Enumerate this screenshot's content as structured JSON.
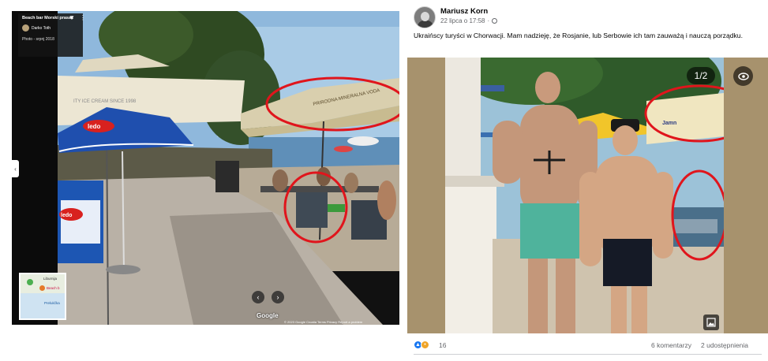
{
  "street_view": {
    "place_title": "Beach bar Morski prasac",
    "contributor": "Darko Toth",
    "photo_date": "Photo - srpnj 2018",
    "map_label_top": "Liburnija",
    "map_label_pin": "Beach b",
    "map_label_water": "Prelukčka",
    "google_label": "Google",
    "footer_text": "© 2023 Google   Croatia   Terms   Privacy   Report a problem",
    "umbrella_text_1": "ITY ICE CREAM SINCE 1998",
    "umbrella_text_2": "PRIRODNA MINERALNA VODA",
    "umbrella_brand": "ledo",
    "fridge_brand": "ledo",
    "highlight_color": "#e0151c",
    "prev_icon": "chevron-left-icon",
    "next_icon": "chevron-right-icon"
  },
  "post": {
    "author": "Mariusz Korn",
    "timestamp": "22 lipca o 17:58",
    "text": "Ukraińscy turyści w Chorwacji. Mam nadzieję, że Rosjanie, lub Serbowie ich tam zauważą i nauczą porządku.",
    "photo_counter": "1/2",
    "umbrella_text": "Jamn",
    "reactions_count": "16",
    "comments": "6 komentarzy",
    "shares": "2 udostępnienia",
    "highlight_color": "#e0151c"
  }
}
